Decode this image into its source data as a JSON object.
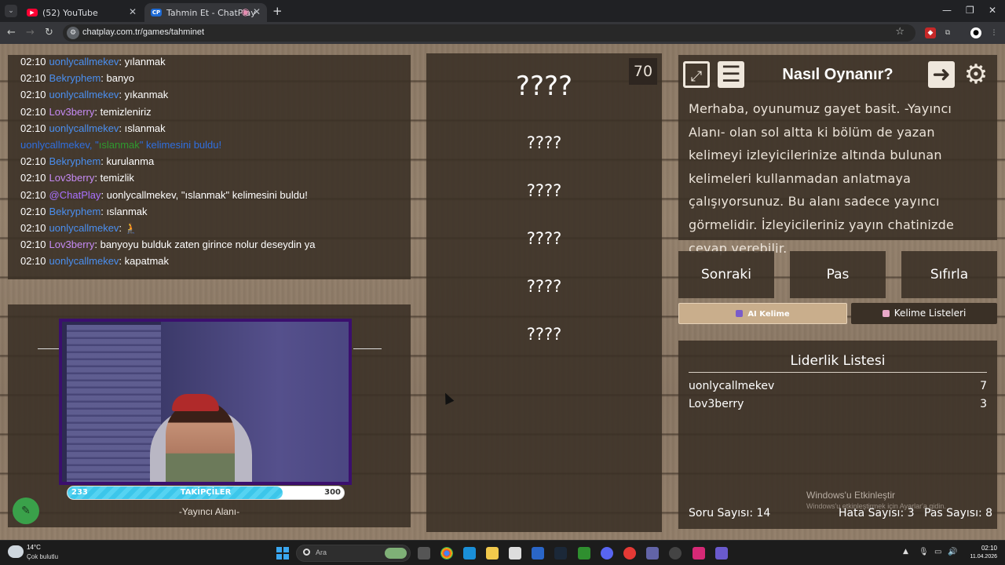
{
  "browser": {
    "tabs": [
      {
        "label": "(52) YouTube",
        "active": false,
        "favicon": "youtube-icon",
        "color": "#ff0033"
      },
      {
        "label": "Tahmin Et - ChatPlay",
        "active": true,
        "favicon": "chatplay-icon",
        "color": "#1e6bd6"
      }
    ],
    "url": "chatplay.com.tr/games/tahminet"
  },
  "chat": {
    "lines": [
      {
        "time": "02:10",
        "user": "uonlycallmekev",
        "user_color": "blue",
        "text": ": yılanmak"
      },
      {
        "time": "02:10",
        "user": "Bekryphem",
        "user_color": "blue",
        "text": ": banyo"
      },
      {
        "time": "02:10",
        "user": "uonlycallmekev",
        "user_color": "blue",
        "text": ": yıkanmak"
      },
      {
        "time": "02:10",
        "user": "Lov3berry",
        "user_color": "purple",
        "text": ": temizleniriz"
      },
      {
        "time": "02:10",
        "user": "uonlycallmekev",
        "user_color": "blue",
        "text": ": ıslanmak"
      },
      {
        "system": true,
        "pre": "uonlycallmekev, \"",
        "word": "ıslanmak",
        "post": "\" kelimesini buldu!"
      },
      {
        "time": "02:10",
        "user": "Bekryphem",
        "user_color": "blue",
        "text": ": kurulanma"
      },
      {
        "time": "02:10",
        "user": "Lov3berry",
        "user_color": "purple",
        "text": ": temizlik"
      },
      {
        "time": "02:10",
        "user": "@ChatPlay",
        "user_color": "chatplay",
        "text": ": uonlycallmekev, \"ıslanmak\" kelimesini buldu!"
      },
      {
        "time": "02:10",
        "user": "Bekryphem",
        "user_color": "blue",
        "text": ": ıslanmak"
      },
      {
        "time": "02:10",
        "user": "uonlycallmekev",
        "user_color": "blue",
        "text": ": 🧎"
      },
      {
        "time": "02:10",
        "user": "Lov3berry",
        "user_color": "purple",
        "text": ": banyoyu bulduk zaten girince nolur deseydin ya"
      },
      {
        "time": "02:10",
        "user": "uonlycallmekev",
        "user_color": "blue",
        "text": ": kapatmak"
      }
    ]
  },
  "streamer": {
    "followers_label": "TAKİPÇİLER",
    "followers_current": "233",
    "followers_goal": "300",
    "followers_progress": 0.777,
    "area_label": "-Yayıncı Alanı-"
  },
  "words": {
    "counter": "70",
    "slots": [
      "????",
      "????",
      "????",
      "????",
      "????",
      "????"
    ]
  },
  "info": {
    "title": "Nasıl Oynanır?",
    "body": "Merhaba, oyunumuz gayet basit. -Yayıncı Alanı- olan sol altta ki bölüm de yazan kelimeyi izleyicilerinize altında bulunan kelimeleri kullanmadan anlatmaya çalışıyorsunuz. Bu alanı sadece yayıncı görmelidir. İzleyicileriniz yayın chatinizde cevap verebilir."
  },
  "controls": {
    "next": "Sonraki",
    "pass": "Pas",
    "reset": "Sıfırla",
    "ai_word": "AI Kelime",
    "word_lists": "Kelime Listeleri"
  },
  "leaderboard": {
    "title": "Liderlik Listesi",
    "rows": [
      {
        "name": "uonlycallmekev",
        "score": "7"
      },
      {
        "name": "Lov3berry",
        "score": "3"
      }
    ],
    "questions": "Soru Sayısı: 14",
    "errors": "Hata Sayısı: 3",
    "passes": "Pas Sayısı: 8"
  },
  "watermark": {
    "line1": "Windows'u Etkinleştir",
    "line2": "Windows'u etkinleştirmek için Ayarlar'a gidin."
  },
  "taskbar": {
    "temp": "14°C",
    "weather": "Çok bulutlu",
    "search_placeholder": "Ara",
    "time": "02:10",
    "date": "11.04.2026"
  },
  "colors": {
    "user_blue": "#4a8ff0",
    "user_purple": "#c68bf5",
    "chatplay": "#a970ff",
    "follow_bar": "#3cc6ea",
    "cam_border": "#3b0f6e"
  }
}
